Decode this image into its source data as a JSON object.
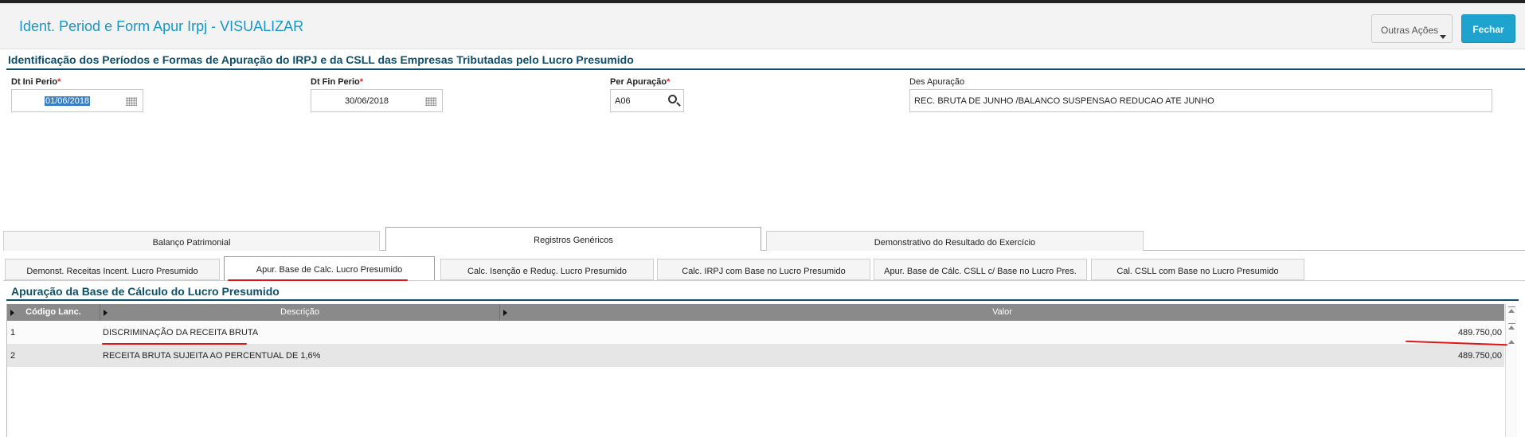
{
  "header": {
    "title": "Ident. Period e Form Apur Irpj - VISUALIZAR",
    "outras_acoes": "Outras Ações",
    "fechar": "Fechar"
  },
  "section_title": "Identificação dos Períodos e Formas de Apuração do IRPJ e da CSLL das Empresas Tributadas pelo Lucro Presumido",
  "form": {
    "dt_ini": {
      "label": "Dt Ini Perio",
      "value": "01/06/2018"
    },
    "dt_fin": {
      "label": "Dt Fin Perio",
      "value": "30/06/2018"
    },
    "per_apuracao": {
      "label": "Per Apuração",
      "value": "A06"
    },
    "des_apuracao": {
      "label": "Des Apuração",
      "value": "REC. BRUTA DE JUNHO /BALANCO SUSPENSAO REDUCAO ATE JUNHO"
    },
    "required_mark": "*"
  },
  "tabs": [
    "Balanço Patrimonial",
    "Registros Genéricos",
    "Demonstrativo do Resultado do Exercício"
  ],
  "active_tab": 1,
  "subtabs": [
    "Demonst. Receitas Incent. Lucro Presumido",
    "Apur. Base de Calc. Lucro Presumido",
    "Calc. Isenção e Reduç. Lucro Presumido",
    "Calc. IRPJ com Base no Lucro Presumido",
    "Apur. Base de Cálc. CSLL c/ Base no Lucro Pres.",
    "Cal. CSLL com Base no Lucro Presumido"
  ],
  "active_subtab": 1,
  "grid": {
    "title": "Apuração da Base de Cálculo do Lucro Presumido",
    "columns": [
      "Código Lanc.",
      "Descrição",
      "Valor"
    ],
    "rows": [
      {
        "codigo": "1",
        "descricao": "DISCRIMINAÇÃO DA RECEITA BRUTA",
        "valor": "489.750,00"
      },
      {
        "codigo": "2",
        "descricao": "RECEITA BRUTA SUJEITA AO PERCENTUAL DE 1,6%",
        "valor": "489.750,00"
      }
    ]
  },
  "colors": {
    "accent": "#1ea3cf",
    "title": "#1a96c7",
    "section": "#0e4f6b",
    "annotation": "#e01515"
  }
}
